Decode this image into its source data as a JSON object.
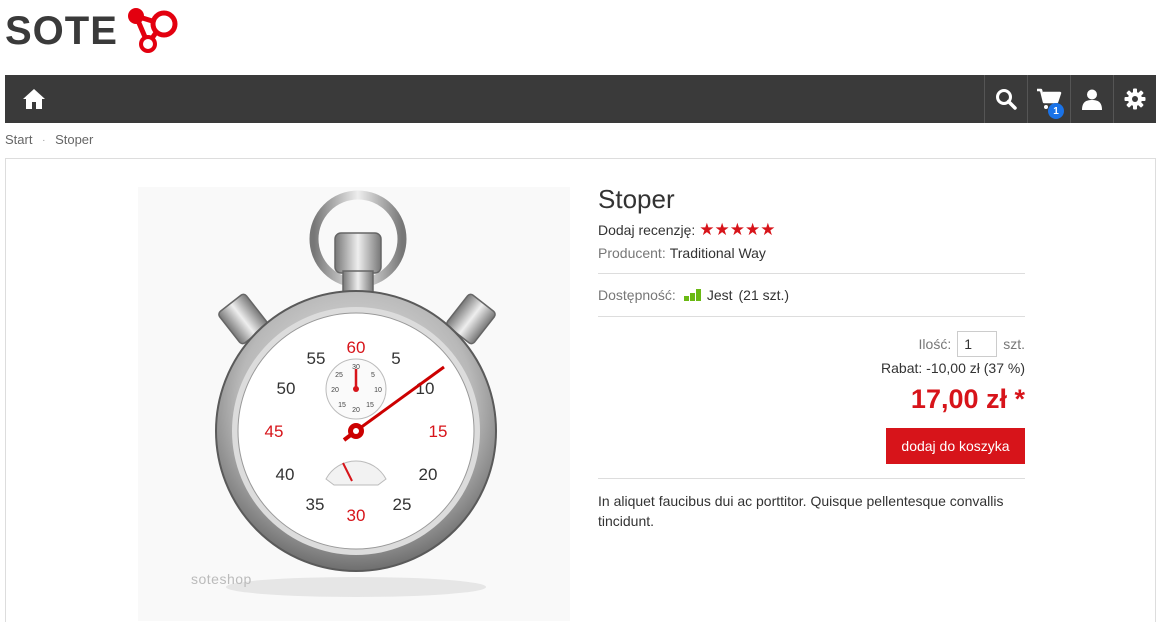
{
  "header": {
    "logo_text": "SOTE",
    "logo_icon": "sote-molecule-icon",
    "brand_color": "#e3000f"
  },
  "navbar": {
    "background": "#3a3a3a",
    "home_icon": "home-icon",
    "search_icon": "search-icon",
    "cart_icon": "cart-icon",
    "cart_count": "1",
    "user_icon": "user-icon",
    "settings_icon": "gear-icon"
  },
  "breadcrumb": {
    "items": [
      "Start",
      "Stoper"
    ],
    "separator": "·"
  },
  "product": {
    "title": "Stoper",
    "review_label": "Dodaj recenzję:",
    "stars": "★★★★★",
    "rating": 5,
    "producer_label": "Producent:",
    "producer_value": "Traditional Way",
    "availability_label": "Dostępność:",
    "availability_value": "Jest",
    "availability_count": "(21 szt.)",
    "availability_level": 3,
    "quantity_label": "Ilość:",
    "quantity_value": "1",
    "quantity_unit": "szt.",
    "discount_text": "Rabat: -10,00 zł (37 %)",
    "price": "17,00 zł *",
    "add_to_cart_label": "dodaj do koszyka",
    "description": "In aliquet faucibus dui ac porttitor. Quisque pellentesque convallis tincidunt.",
    "image_watermark": "soteshop",
    "accent_color": "#d7141a",
    "availability_color": "#6ab914"
  }
}
